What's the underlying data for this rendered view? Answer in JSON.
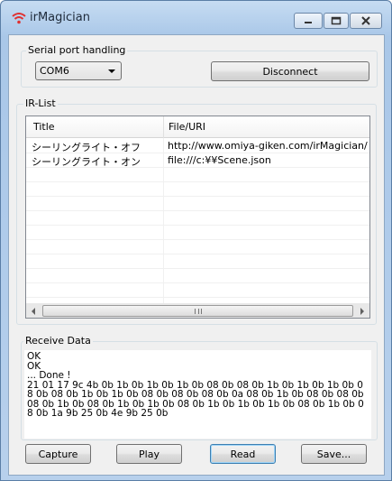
{
  "window": {
    "title": "irMagician",
    "icon": "wifi-icon",
    "controls": [
      "minimize-icon",
      "maximize-icon",
      "close-icon"
    ]
  },
  "serial": {
    "group_label": "Serial port handling",
    "port_selected": "COM6",
    "disconnect_label": "Disconnect"
  },
  "irlist": {
    "group_label": "IR-List",
    "columns": {
      "title": "Title",
      "file": "File/URI"
    },
    "rows": [
      {
        "title": "シーリングライト・オフ",
        "file": "http://www.omiya-giken.com/irMagician/..."
      },
      {
        "title": "シーリングライト・オン",
        "file": "file:///c:¥¥Scene.json"
      }
    ],
    "scroll_grip": "III"
  },
  "receive": {
    "group_label": "Receive Data",
    "text": "OK\nOK\n... Done !\n21 01 17 9c 4b 0b 1b 0b 1b 0b 1b 0b 08 0b 08 0b 1b 0b 1b 0b 1b 0b 08 0b 08 0b 1b 0b 1b 0b 08 0b 08 0b 08 0b 0a 08 0b 1b 0b 08 0b 08 0b 08 0b 1b 0b 08 0b 1b 0b 1b 0b 08 0b 1b 0b 1b 0b 1b 0b 08 0b 1b 0b 08 0b 1a 9b 25 0b 4e 9b 25 0b"
  },
  "buttons": {
    "capture": "Capture",
    "play": "Play",
    "read": "Read",
    "save": "Save..."
  }
}
